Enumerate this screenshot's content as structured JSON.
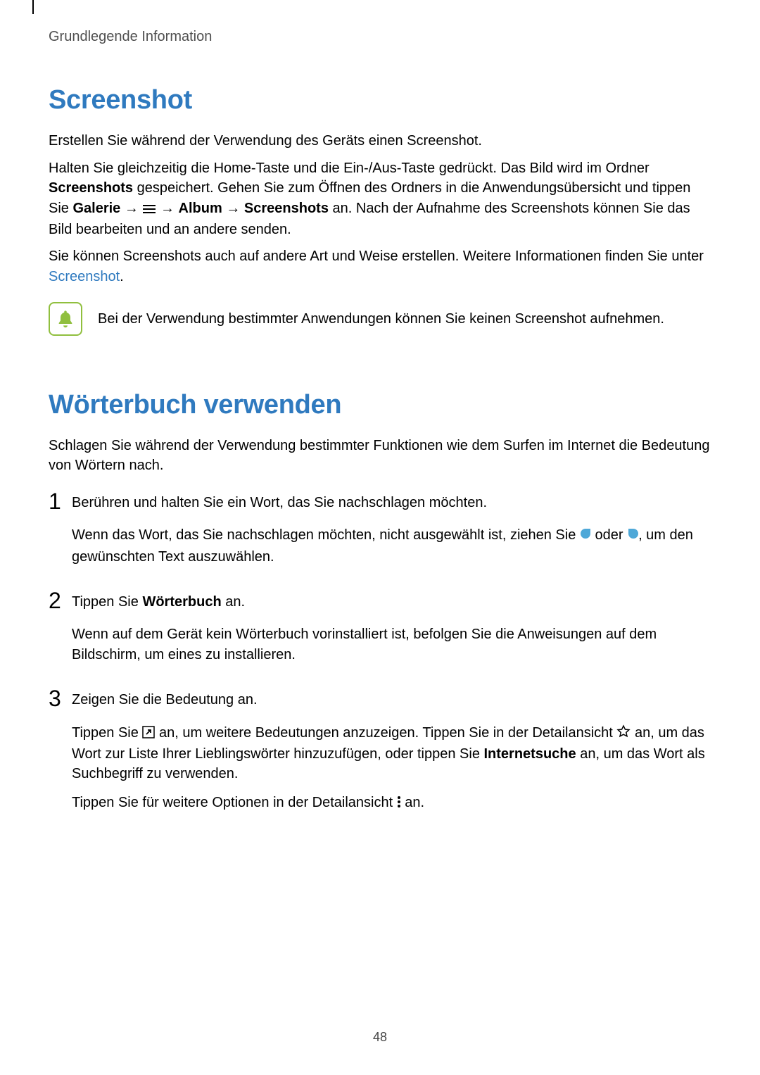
{
  "header": {
    "breadcrumb": "Grundlegende Information"
  },
  "section1": {
    "title": "Screenshot",
    "p1": "Erstellen Sie während der Verwendung des Geräts einen Screenshot.",
    "p2a": "Halten Sie gleichzeitig die Home-Taste und die Ein-/Aus-Taste gedrückt. Das Bild wird im Ordner ",
    "p2b": "Screenshots",
    "p2c": " gespeichert. Gehen Sie zum Öffnen des Ordners in die Anwendungsübersicht und tippen Sie ",
    "p2d": "Galerie",
    "arrow": " → ",
    "p2e": "Album",
    "p2f": "Screenshots",
    "p2g": " an. Nach der Aufnahme des Screenshots können Sie das Bild bearbeiten und an andere senden.",
    "p3a": "Sie können Screenshots auch auf andere Art und Weise erstellen. Weitere Informationen finden Sie unter ",
    "p3link": "Screenshot",
    "p3b": ".",
    "note": "Bei der Verwendung bestimmter Anwendungen können Sie keinen Screenshot aufnehmen."
  },
  "section2": {
    "title": "Wörterbuch verwenden",
    "intro": "Schlagen Sie während der Verwendung bestimmter Funktionen wie dem Surfen im Internet die Bedeutung von Wörtern nach.",
    "step1": {
      "num": "1",
      "p1": "Berühren und halten Sie ein Wort, das Sie nachschlagen möchten.",
      "p2a": "Wenn das Wort, das Sie nachschlagen möchten, nicht ausgewählt ist, ziehen Sie ",
      "p2b": " oder ",
      "p2c": ", um den gewünschten Text auszuwählen."
    },
    "step2": {
      "num": "2",
      "p1a": "Tippen Sie ",
      "p1b": "Wörterbuch",
      "p1c": " an.",
      "p2": "Wenn auf dem Gerät kein Wörterbuch vorinstalliert ist, befolgen Sie die Anweisungen auf dem Bildschirm, um eines zu installieren."
    },
    "step3": {
      "num": "3",
      "p1": "Zeigen Sie die Bedeutung an.",
      "p2a": "Tippen Sie ",
      "p2b": " an, um weitere Bedeutungen anzuzeigen. Tippen Sie in der Detailansicht ",
      "p2c": " an, um das Wort zur Liste Ihrer Lieblingswörter hinzuzufügen, oder tippen Sie ",
      "p2d": "Internetsuche",
      "p2e": " an, um das Wort als Suchbegriff zu verwenden.",
      "p3a": "Tippen Sie für weitere Optionen in der Detailansicht ",
      "p3b": " an."
    }
  },
  "page_number": "48"
}
